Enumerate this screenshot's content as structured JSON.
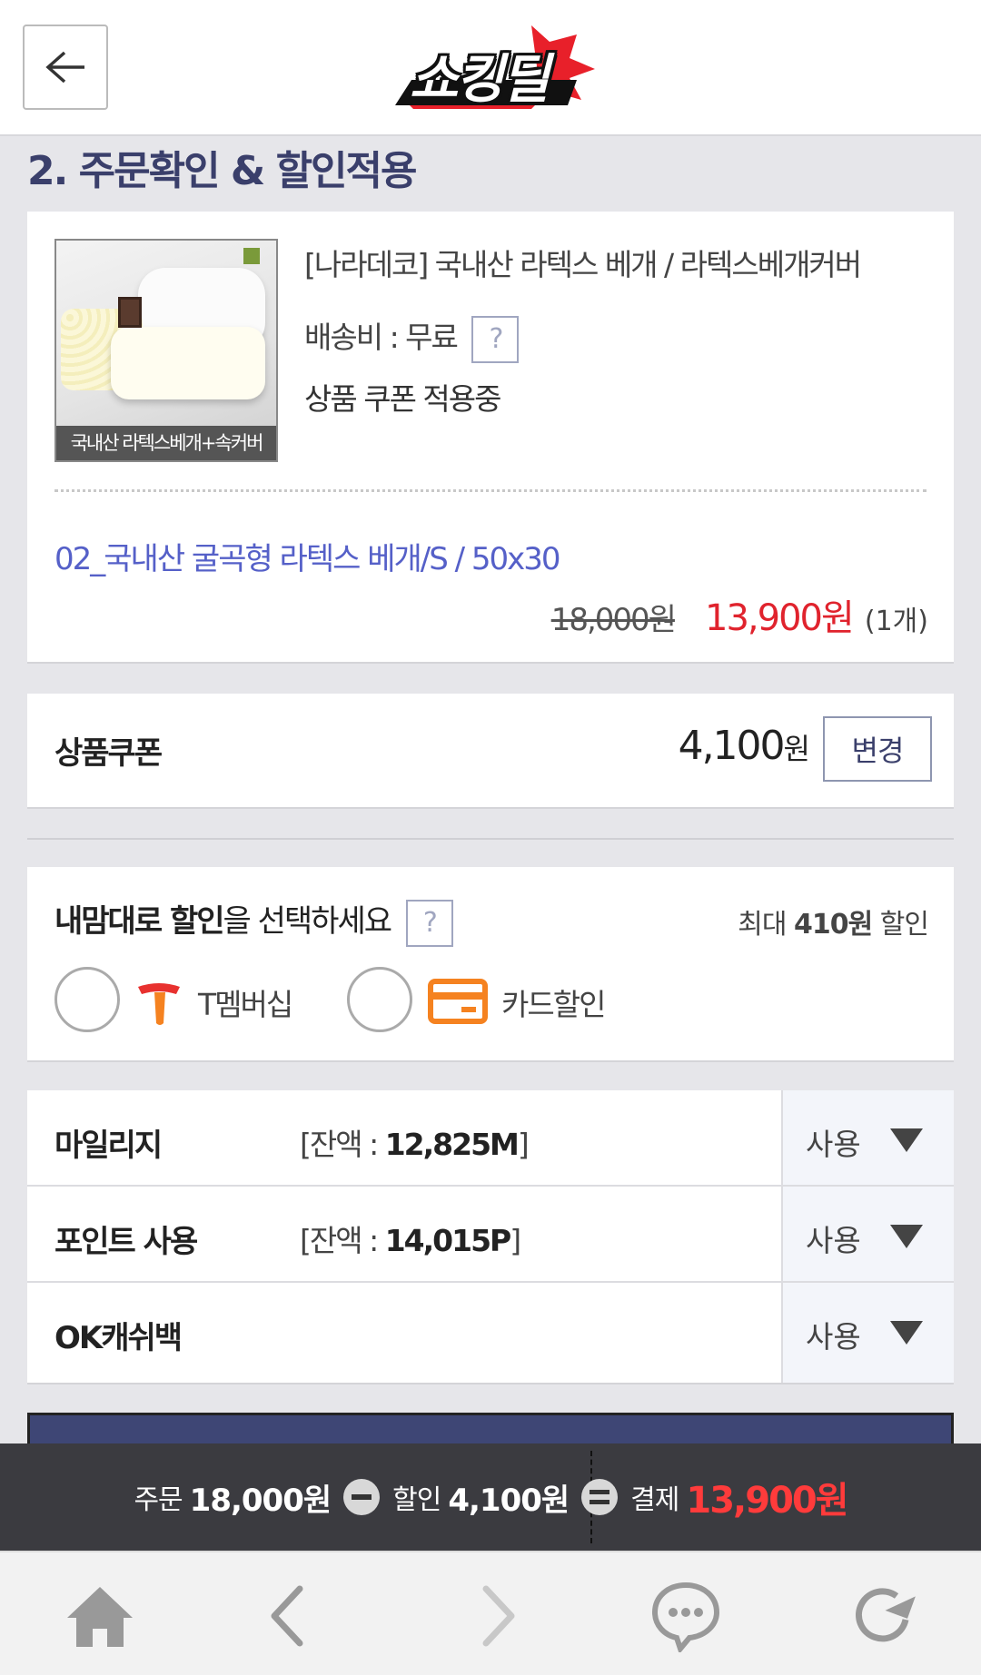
{
  "header": {
    "logo_text": "쇼킹딜"
  },
  "section_title": "2. 주문확인 & 할인적용",
  "product": {
    "thumbnail_caption": "국내산 라텍스베개+속커버",
    "name": "[나라데코] 국내산 라텍스 베개 / 라텍스베개커버",
    "shipping": "배송비 : 무료",
    "help_mark": "?",
    "coupon_status": "상품 쿠폰 적용중",
    "option": "02_국내산 굴곡형 라텍스 베개/S / 50x30",
    "original_price": "18,000원",
    "sale_price": "13,900원",
    "quantity": "(1개)"
  },
  "coupon": {
    "label": "상품쿠폰",
    "amount": "4,100",
    "unit": "원",
    "change_label": "변경"
  },
  "discount": {
    "title_bold": "내맘대로 할인",
    "title_rest": "을 선택하세요",
    "help_mark": "?",
    "max_prefix": "최대 ",
    "max_amount": "410원",
    "max_suffix": " 할인",
    "options": [
      {
        "label": "T멤버십"
      },
      {
        "label": "카드할인"
      }
    ]
  },
  "usage": [
    {
      "label": "마일리지",
      "balance_prefix": "[잔액 : ",
      "balance": "12,825M",
      "balance_suffix": "]",
      "use_label": "사용"
    },
    {
      "label": "포인트 사용",
      "balance_prefix": "[잔액 : ",
      "balance": "14,015P",
      "balance_suffix": "]",
      "use_label": "사용"
    },
    {
      "label": "OK캐쉬백",
      "use_label": "사용"
    }
  ],
  "summary": {
    "order_label": "주문",
    "order_amount": "18,000원",
    "discount_label": "할인",
    "discount_amount": "4,100원",
    "pay_label": "결제",
    "pay_amount": "13,900원"
  },
  "colors": {
    "title": "#3a3f6b",
    "sale": "#e0232d",
    "option": "#5560c8",
    "summary_bg": "#3b3b40",
    "summary_total": "#ff3b3b",
    "tmember": "#e8312f",
    "card": "#f58220"
  },
  "nav_icons": [
    "home-icon",
    "back-icon",
    "forward-icon",
    "chat-icon",
    "refresh-icon"
  ]
}
